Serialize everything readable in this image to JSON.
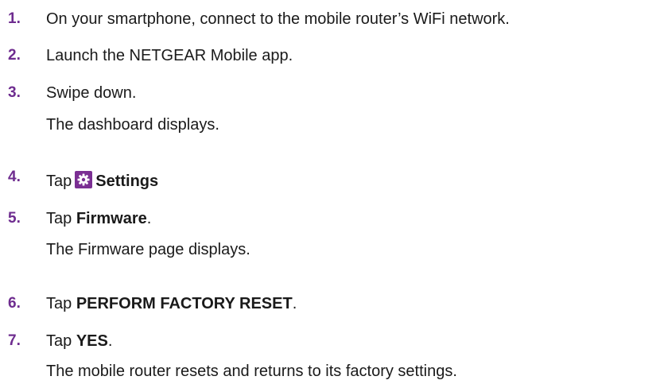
{
  "steps": [
    {
      "number": "1.",
      "text": "On your smartphone, connect to the mobile router’s WiFi network."
    },
    {
      "number": "2.",
      "text": "Launch the NETGEAR Mobile app."
    },
    {
      "number": "3.",
      "text": "Swipe down.",
      "result": "The dashboard displays."
    },
    {
      "number": "4.",
      "prefix": "Tap",
      "bold": "Settings",
      "icon": "settings-gear-icon",
      "icon_color": "#7b2f93"
    },
    {
      "number": "5.",
      "prefix": "Tap",
      "bold": "Firmware",
      "suffix": ".",
      "result": "The Firmware page displays."
    },
    {
      "number": "6.",
      "prefix": "Tap",
      "bold": "PERFORM FACTORY RESET",
      "suffix": "."
    },
    {
      "number": "7.",
      "prefix": "Tap",
      "bold": "YES",
      "suffix": ".",
      "result": "The mobile router resets and returns to its factory settings."
    }
  ],
  "colors": {
    "step_number": "#6e2c8f",
    "body_text": "#1a1a1a"
  }
}
